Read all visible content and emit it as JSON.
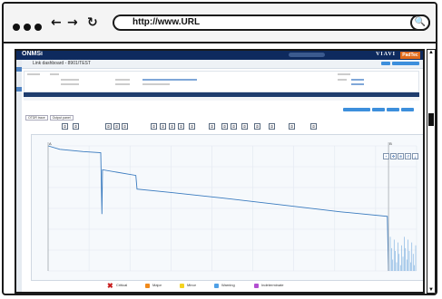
{
  "browser": {
    "url": "http://www.URL",
    "back_icon": "←",
    "forward_icon": "→",
    "reload_icon": "↻",
    "search_icon": "🔍"
  },
  "app": {
    "brand": "ONMSi",
    "vendor": "VIAVI",
    "partner_logo": "PadTec",
    "page_title": "Link dashboard - 8901/TEST",
    "accent": "#0e2a5e",
    "primary_button_color": "#3d8fdc"
  },
  "tabs": [
    {
      "label": "OTDR trace"
    },
    {
      "label": "Output panel"
    }
  ],
  "legend": {
    "critical": "Critical",
    "major": "Major",
    "minor": "Minor",
    "warning": "Warning",
    "indeterminate": "Indeterminate",
    "colors": {
      "critical": "#c81d1d",
      "major": "#f08a1c",
      "minor": "#f5d320",
      "warning": "#4fa0e6",
      "indeterminate": "#b24fd0"
    }
  },
  "chart_data": {
    "type": "line",
    "title": "",
    "xlabel": "",
    "ylabel": "",
    "series": [
      {
        "values": [
          [
            0,
            0.0
          ],
          [
            2,
            0.3
          ],
          [
            6,
            0.5
          ],
          [
            9,
            0.6
          ],
          [
            9.2,
            6.0
          ],
          [
            9.3,
            2.1
          ],
          [
            15,
            2.6
          ],
          [
            15.2,
            3.8
          ],
          [
            21,
            4.1
          ],
          [
            30,
            4.6
          ],
          [
            40,
            5.2
          ],
          [
            50,
            5.8
          ],
          [
            58,
            6.2
          ],
          [
            58.2,
            11.0
          ]
        ]
      }
    ],
    "noise_region": {
      "x_start": 58.5,
      "x_end": 63
    },
    "markers": [
      "A",
      "B"
    ],
    "grid": true
  }
}
